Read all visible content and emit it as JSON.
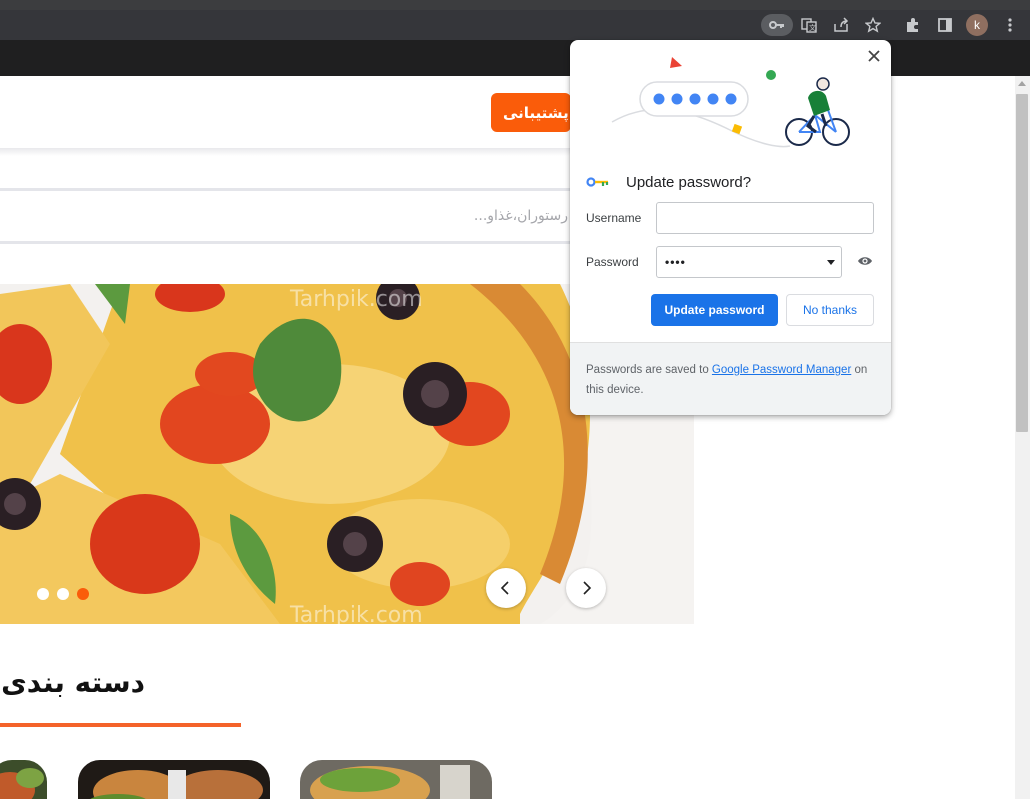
{
  "browser": {
    "avatar_letter": "k",
    "toolbar_icons": [
      "key-icon",
      "translate-icon",
      "share-icon",
      "star-icon",
      "extensions-icon",
      "side-panel-icon",
      "menu-icon"
    ]
  },
  "page": {
    "support_label": "پشتیبانی",
    "search_placeholder": "رستوران،غذاو...",
    "categories_title": "دسته بندی‌ها",
    "accent_color": "#fa5c0a",
    "watermark": "Tarhpik.com",
    "slider": {
      "prev_icon": "chevron-left-icon",
      "next_icon": "chevron-right-icon",
      "dots": 3,
      "active_dot": 3
    }
  },
  "password_popup": {
    "title": "Update password?",
    "username_label": "Username",
    "username_value": "",
    "password_label": "Password",
    "password_value": "••••",
    "update_label": "Update password",
    "no_thanks_label": "No thanks",
    "footer_prefix": "Passwords are saved to ",
    "footer_link": "Google Password Manager",
    "footer_suffix": " on this device.",
    "primary_color": "#1a73e8"
  }
}
